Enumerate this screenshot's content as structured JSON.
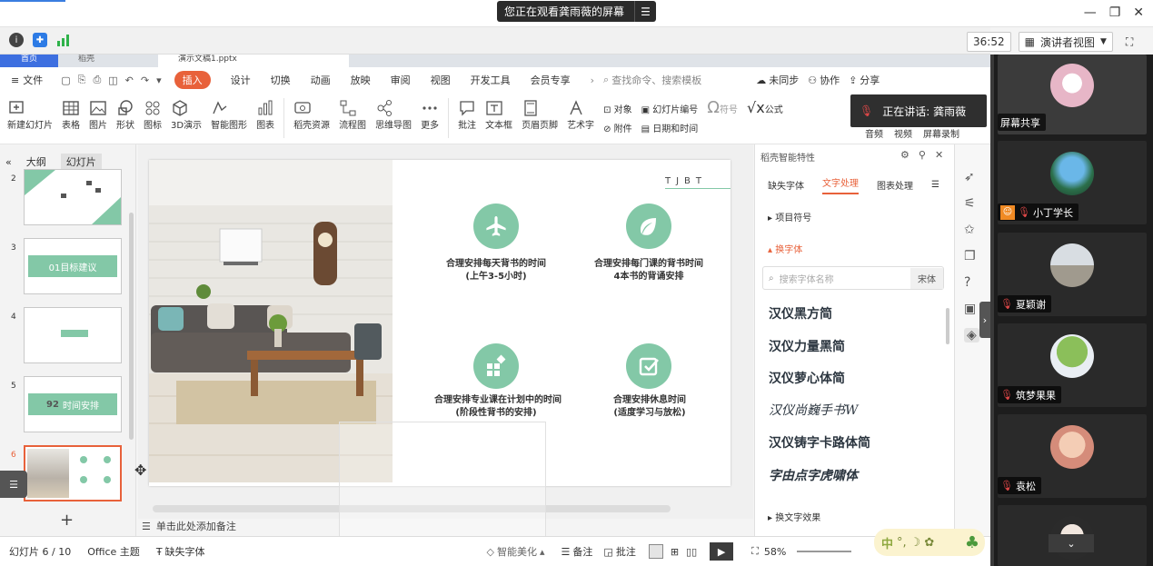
{
  "meeting": {
    "share_banner": "您正在观看龚雨薇的屏幕",
    "timer": "36:52",
    "view_mode": "演讲者视图",
    "speaking_label": "正在讲话: 龚雨薇"
  },
  "wps": {
    "tabs": [
      "首页",
      "稻壳",
      "演示文稿1.pptx"
    ],
    "menu": {
      "file": "文件",
      "tabs": [
        "插入",
        "设计",
        "切换",
        "动画",
        "放映",
        "审阅",
        "视图",
        "开发工具",
        "会员专享"
      ],
      "search_placeholder": "查找命令、搜索模板",
      "unsynced": "未同步",
      "collab": "协作",
      "share": "分享"
    },
    "ribbon": [
      "新建幻灯片",
      "表格",
      "图片",
      "形状",
      "图标",
      "3D演示",
      "智能图形",
      "图表",
      "稻壳资源",
      "流程图",
      "思维导图",
      "更多",
      "批注",
      "文本框",
      "页眉页脚",
      "艺术字"
    ],
    "ribbon_small": [
      "对象",
      "幻灯片编号",
      "附件",
      "日期和时间"
    ],
    "ribbon_right": [
      "符号",
      "公式",
      "音频",
      "视频",
      "屏幕录制"
    ]
  },
  "left_panel": {
    "tabs": [
      "大纲",
      "幻灯片"
    ],
    "slides": [
      {
        "num": "2",
        "label": ""
      },
      {
        "num": "3",
        "label": "01目标建议"
      },
      {
        "num": "4",
        "label": ""
      },
      {
        "num": "5",
        "label": "时间安排"
      },
      {
        "num": "6",
        "label": ""
      }
    ],
    "thumb3_prefix": "01",
    "thumb5_prefix": "92"
  },
  "slide": {
    "corner_mark": "TJBT",
    "items": [
      {
        "line1": "合理安排每天背书的时间",
        "line2": "(上午3-5小时)"
      },
      {
        "line1": "合理安排每门课的背书时间",
        "line2": "4本书的背诵安排"
      },
      {
        "line1": "合理安排专业课在计划中的时间",
        "line2": "(阶段性背书的安排)"
      },
      {
        "line1": "合理安排休息时间",
        "line2": "(适度学习与放松)"
      }
    ]
  },
  "notes_placeholder": "单击此处添加备注",
  "right_panel": {
    "title": "稻壳智能特性",
    "tabs": [
      "缺失字体",
      "文字处理",
      "图表处理"
    ],
    "section_bullets": "项目符号",
    "section_fonts": "换字体",
    "font_search_placeholder": "搜索字体名称",
    "current_font": "宋体",
    "fonts": [
      "汉仪黑方简",
      "汉仪力量黑简",
      "汉仪萝心体简",
      "汉仪尚巍手书W",
      "汉仪铸字卡路体简",
      "字由点字虎啸体"
    ],
    "section_effects": "换文字效果"
  },
  "status": {
    "slide_count": "幻灯片 6 / 10",
    "theme": "Office 主题",
    "missing_fonts": "缺失字体",
    "beautify": "智能美化",
    "notes": "备注",
    "comments": "批注",
    "zoom": "58%"
  },
  "participants": [
    {
      "name": "屏幕共享"
    },
    {
      "name": "小丁学长"
    },
    {
      "name": "夏颖谢"
    },
    {
      "name": "筑梦果果"
    },
    {
      "name": "袁松"
    },
    {
      "name": ""
    }
  ],
  "colors": {
    "accent": "#83c8a7",
    "wps_orange": "#e8613a",
    "wps_tab_active": "#d65d33"
  }
}
